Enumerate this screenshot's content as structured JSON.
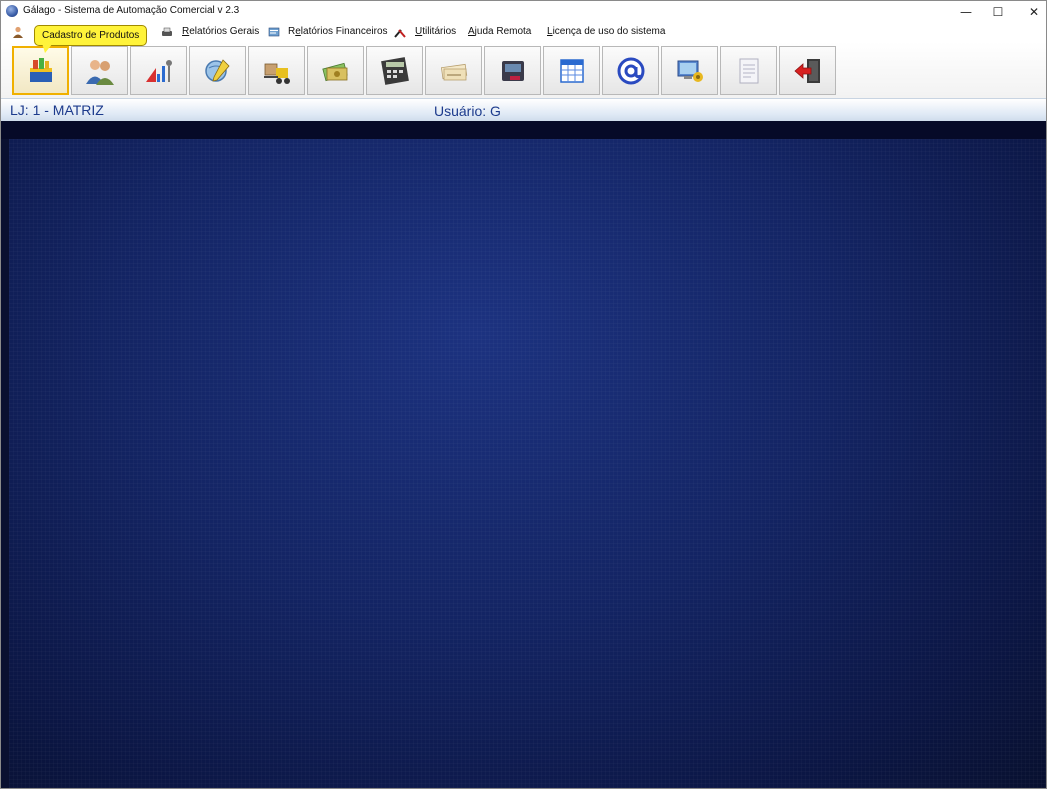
{
  "window": {
    "title": "Gálago - Sistema de Automação Comercial v 2.3",
    "minimize_glyph": "—",
    "maximize_glyph": "☐",
    "close_glyph": "✕"
  },
  "menu": {
    "items": [
      {
        "prefix": "",
        "accel": "R",
        "rest": "elatórios Gerais",
        "icon": "printer-icon"
      },
      {
        "prefix": "R",
        "accel": "e",
        "rest": "latórios Financeiros",
        "icon": "financial-report-icon"
      },
      {
        "prefix": "",
        "accel": "U",
        "rest": "tilitários",
        "icon": "tools-icon"
      },
      {
        "prefix": "",
        "accel": "A",
        "rest": "juda Remota",
        "icon": ""
      },
      {
        "prefix": "",
        "accel": "L",
        "rest": "icença de uso do sistema",
        "icon": ""
      }
    ]
  },
  "tooltip": {
    "text": "Cadastro de Produtos"
  },
  "toolbar": {
    "buttons": [
      {
        "name": "products-button",
        "icon": "products-box-icon",
        "active": true
      },
      {
        "name": "clients-button",
        "icon": "people-icon"
      },
      {
        "name": "sales-button",
        "icon": "sales-chart-icon"
      },
      {
        "name": "services-button",
        "icon": "globe-pencil-icon"
      },
      {
        "name": "stock-button",
        "icon": "forklift-icon"
      },
      {
        "name": "finance-button",
        "icon": "money-icon"
      },
      {
        "name": "calculator-button",
        "icon": "calculator-icon"
      },
      {
        "name": "checks-button",
        "icon": "checks-icon"
      },
      {
        "name": "pos-button",
        "icon": "pos-terminal-icon"
      },
      {
        "name": "calendar-button",
        "icon": "spreadsheet-icon"
      },
      {
        "name": "email-button",
        "icon": "at-icon"
      },
      {
        "name": "remote-button",
        "icon": "monitor-key-icon"
      },
      {
        "name": "notes-button",
        "icon": "document-icon"
      },
      {
        "name": "exit-button",
        "icon": "exit-door-icon"
      }
    ]
  },
  "status": {
    "store": "LJ: 1 - MATRIZ",
    "user": "Usuário:  G"
  },
  "colors": {
    "status_text": "#1c3a8c",
    "desktop_bg": "#132463",
    "tooltip_bg": "#fff33a"
  }
}
